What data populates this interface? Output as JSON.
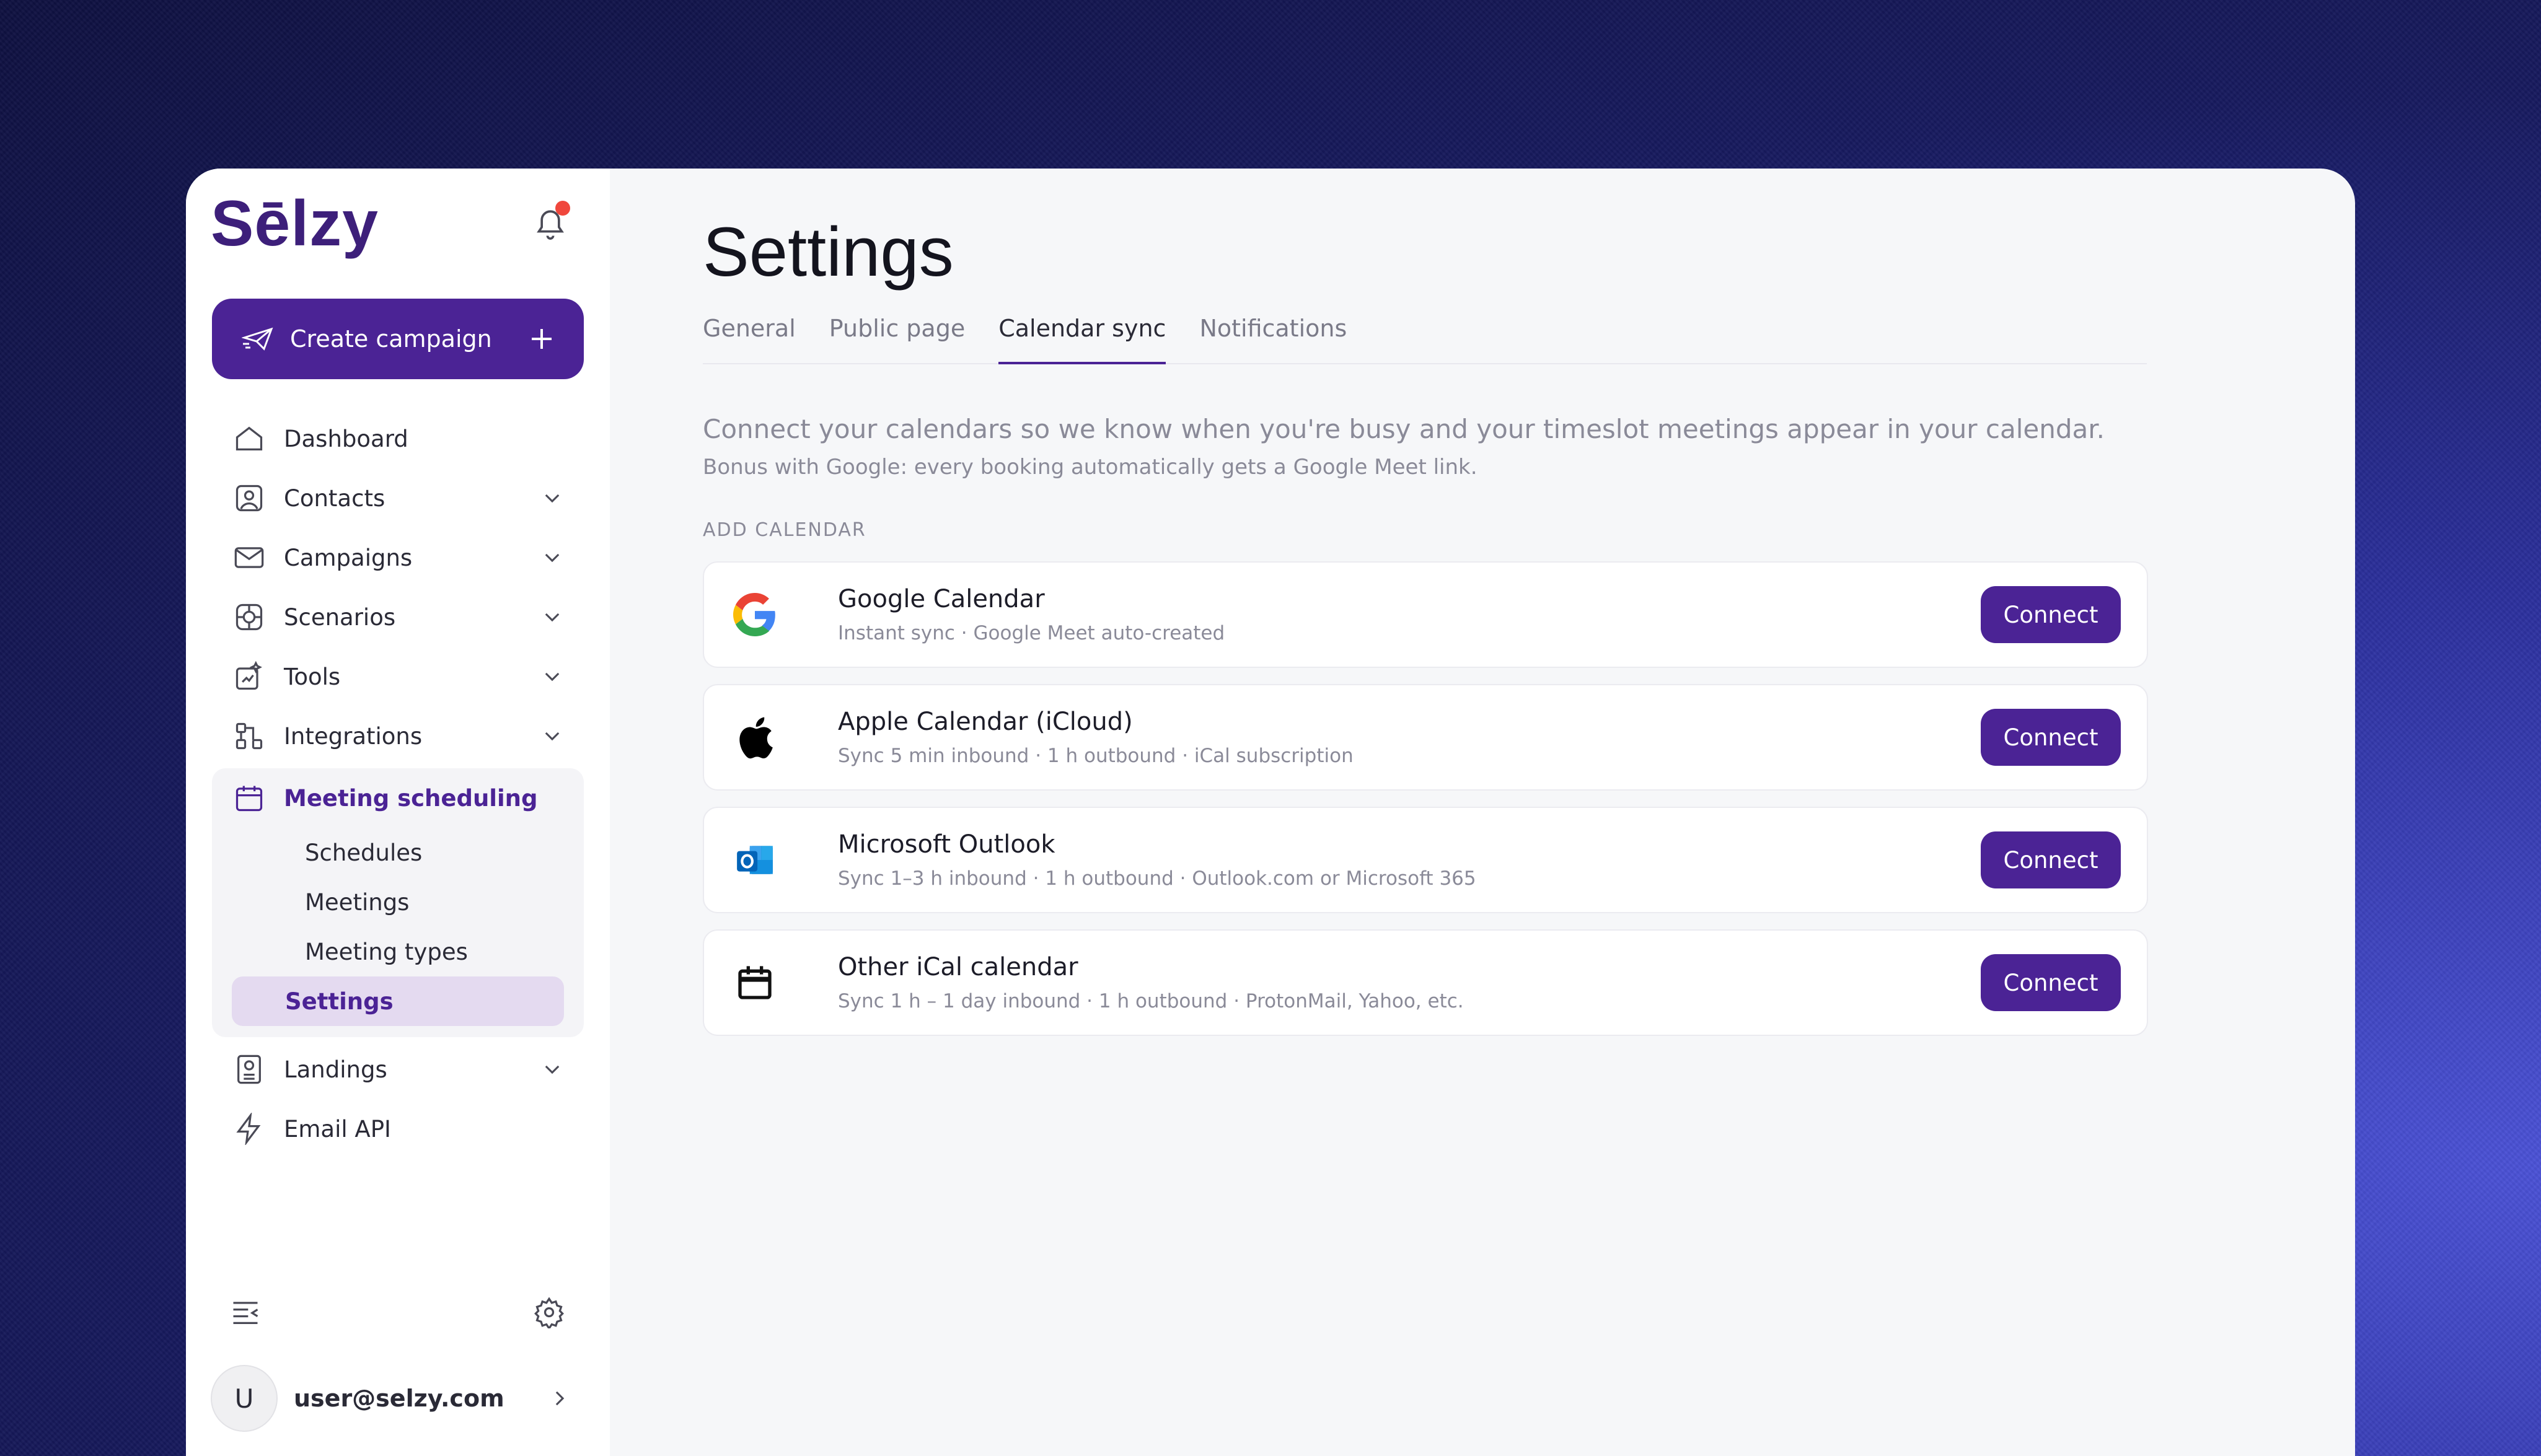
{
  "app": {
    "logo_text": "Sēlzy"
  },
  "sidebar": {
    "create_label": "Create campaign",
    "items": [
      {
        "label": "Dashboard"
      },
      {
        "label": "Contacts"
      },
      {
        "label": "Campaigns"
      },
      {
        "label": "Scenarios"
      },
      {
        "label": "Tools"
      },
      {
        "label": "Integrations"
      }
    ],
    "group": {
      "label": "Meeting scheduling",
      "subitems": [
        "Schedules",
        "Meetings",
        "Meeting types",
        "Settings"
      ]
    },
    "after": [
      {
        "label": "Landings"
      },
      {
        "label": "Email API"
      }
    ],
    "user": {
      "initial": "U",
      "email": "user@selzy.com"
    }
  },
  "main": {
    "title": "Settings",
    "tabs": [
      "General",
      "Public page",
      "Calendar sync",
      "Notifications"
    ],
    "active_tab": "Calendar sync",
    "description": "Connect your calendars so we know when you're busy and your timeslot meetings appear in your calendar.",
    "description2": "Bonus with Google: every booking automatically gets a Google Meet link.",
    "section_label": "ADD CALENDAR",
    "calendars": [
      {
        "name": "Google Calendar",
        "meta": "Instant sync · Google Meet auto-created",
        "button": "Connect",
        "icon": "google-icon"
      },
      {
        "name": "Apple Calendar (iCloud)",
        "meta": "Sync 5 min inbound · 1 h outbound · iCal subscription",
        "button": "Connect",
        "icon": "apple-icon"
      },
      {
        "name": "Microsoft Outlook",
        "meta": "Sync 1–3 h inbound · 1 h outbound · Outlook.com or Microsoft 365",
        "button": "Connect",
        "icon": "outlook-icon"
      },
      {
        "name": "Other iCal calendar",
        "meta": "Sync 1 h – 1 day inbound · 1 h outbound · ProtonMail, Yahoo, etc.",
        "button": "Connect",
        "icon": "calendar-icon"
      }
    ]
  },
  "colors": {
    "accent": "#4b2395",
    "muted": "#8a8a98",
    "notification": "#f0473c"
  }
}
